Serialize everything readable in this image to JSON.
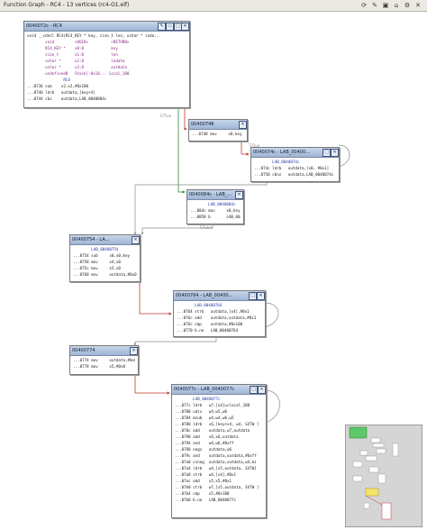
{
  "window": {
    "title": "Function Graph - RC4 - 13 vertices  (rc4-O1.elf)",
    "icons": [
      "refresh-icon",
      "edit-icon",
      "camera-icon",
      "home-icon",
      "settings-icon",
      "close-icon"
    ]
  },
  "nodes": {
    "rc4": {
      "title": "0040072c - RC4",
      "lines": [
        "void __cdecl RC4(RC4_KEY * key, size_t len, uchar * inda...",
        "        void         <VOID>          <RETURN>",
        "        RC4_KEY *    x0:8            key",
        "        size_t       x1:8            len",
        "        uchar *      x2:8            indata",
        "        uchar *      x3:8            outdata",
        "        undefined8   Stack[-0x10... local_100",
        "                RC4",
        "...0736 sub    x2,x2,#0x100",
        "...0740 ldrb   outdata,[key+4]",
        "...0744 cbz    outdata,LAB_0040084c"
      ]
    },
    "n748": {
      "title": "00400748",
      "lines": [
        "...0748 mov     x0,key"
      ]
    },
    "n74c": {
      "title": "0040074c - LAB_00400...",
      "lines": [
        "        LAB_0040074c",
        "...074c ldrb   outdata,[x0, #0x1]",
        "...0750 cbnz   outdata,LAB_0040074c"
      ]
    },
    "n84c": {
      "title": "0040084c - LAB_...",
      "lines": [
        "        LAB_0040084c",
        "...084c mov     x0,key",
        "...0858 b       LAB_00400754"
      ]
    },
    "n754": {
      "title": "00400754 - LA...",
      "lines": [
        "        LAB_00400754",
        "...0754 sub     x0,x0,key",
        "...0758 mov     x4,x0",
        "...075c mov     x5,x0",
        "...0760 mov     outdata,#0x0"
      ]
    },
    "n764": {
      "title": "00400764 - LAB_00400...",
      "lines": [
        "        LAB_00400764",
        "...0764 strb   outdata,[x4],#0x1",
        "...076c add    outdata,outdata,#0x1",
        "...076c cmp    outdata,#0x100",
        "...0770 b.ne   LAB_00400764"
      ]
    },
    "n774": {
      "title": "00400774",
      "lines": [
        "...0774 mov     outdata,#0x0",
        "...0778 mov     x5,#0x0"
      ]
    },
    "n77c": {
      "title": "0040077c - LAB_0040077c",
      "lines": [
        "        LAB_0040077c",
        "...077c ldrb   w7,[x4]=>local_100",
        "...0780 udiv   w4,w5,w6",
        "...0784 msub   w4,w4,w6,w5",
        "...0788 ldrb   x6,[key+x4, w4, SXTW ]",
        "...078c add    outdata,w7,outdata",
        "...0790 add    x6,x6,outdata",
        "...0794 and    w4,w6,#0xff",
        "...0798 negs   outdata,w6",
        "...079c and    outdata,outdata,#0xff",
        "...07a0 csneg  outdata,outdata,w4,mi",
        "...07a4 ldrb   w4,[x5,outdata, SXTW]",
        "...07a8 strb   w4,[x4],#0x1",
        "...07ac add    x5,x5,#0x1",
        "...07b0 strb   w7,[x5,outdata, SXTW ]",
        "...07b4 cmp    x5,#0x100",
        "...07b8 b.ne   LAB_0040077c"
      ]
    }
  },
  "edge_labels": [
    "F/True",
    "T/True",
    "F/False"
  ]
}
